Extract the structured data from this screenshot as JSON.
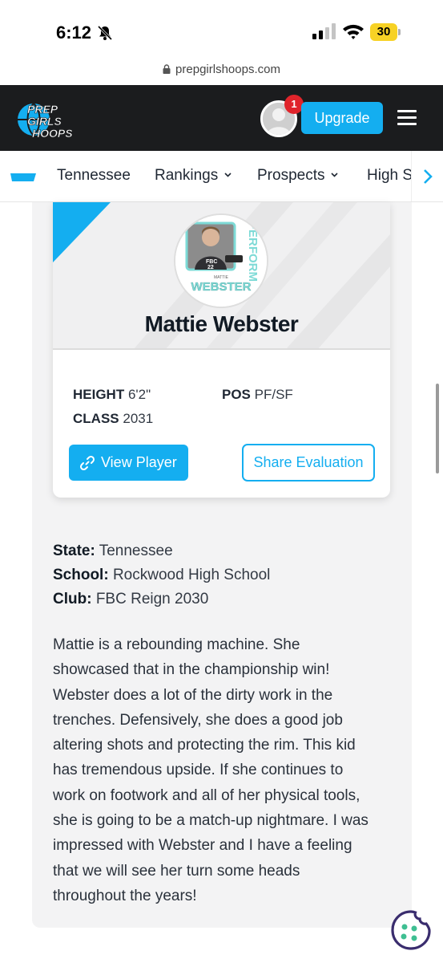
{
  "status_bar": {
    "time": "6:12",
    "battery": "30",
    "icons": [
      "bell-off-icon",
      "cellular-signal-icon",
      "wifi-icon",
      "battery-charging-icon"
    ]
  },
  "browser": {
    "url": "prepgirlshoops.com"
  },
  "header": {
    "logo_text": [
      "PREP",
      "GIRLS",
      "HOOPS"
    ],
    "notification_count": "1",
    "upgrade_label": "Upgrade",
    "accent_color": "#14aef0",
    "background_color": "#1b1c1e"
  },
  "sub_nav": {
    "items": [
      {
        "label": "Tennessee",
        "has_dropdown": false
      },
      {
        "label": "Rankings",
        "has_dropdown": true
      },
      {
        "label": "Prospects",
        "has_dropdown": true
      },
      {
        "label": "High S",
        "has_dropdown": false
      }
    ]
  },
  "player_card": {
    "photo_caption_small": "MATTIE",
    "photo_caption_large": "WEBSTER",
    "photo_side_text": "PERFORM",
    "name": "Mattie Webster",
    "height_label": "HEIGHT",
    "height_value": "6'2\"",
    "pos_label": "POS",
    "pos_value": "PF/SF",
    "class_label": "CLASS",
    "class_value": "2031",
    "view_player_label": "View Player",
    "share_label": "Share Evaluation"
  },
  "details": {
    "state_label": "State:",
    "state_value": "Tennessee",
    "school_label": "School:",
    "school_value": "Rockwood High School",
    "club_label": "Club:",
    "club_value": "FBC Reign 2030"
  },
  "bio": "Mattie is a rebounding machine. She showcased that in the championship win! Webster does a lot of the dirty work in the trenches. Defensively, she does a good job altering shots and protecting the rim. This kid has tremendous upside. If she continues to work on footwork and all of her physical tools, she is going to be a match-up nightmare. I was impressed with Webster and I have a feeling that we will see her turn some heads throughout the years!"
}
